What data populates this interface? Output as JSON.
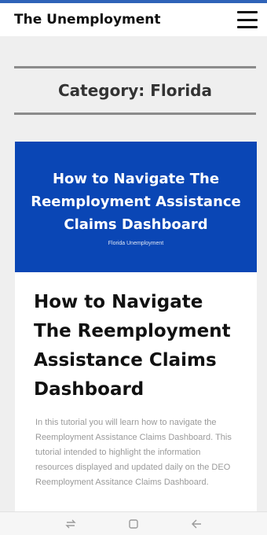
{
  "header": {
    "site_title": "The Unemployment",
    "menu_icon": "hamburger-menu-icon"
  },
  "category": {
    "title": "Category: Florida"
  },
  "post": {
    "banner_title": "How to Navigate The Reemployment Assistance Claims Dashboard",
    "banner_subtitle": "Florida Unemployment",
    "title": "How to Navigate The Reemployment Assistance Claims Dashboard",
    "excerpt": "In this tutorial you will learn how to navigate the Reemployment Assistance Claims Dashboard. This tutorial intended to highlight the information resources displayed and updated daily on the DEO Reemployment Assitance Claims Dashboard.",
    "banner_color": "#0a46b5"
  },
  "system_nav": {
    "recents_icon": "recents-icon",
    "home_icon": "home-square-icon",
    "back_icon": "back-arrow-icon"
  },
  "colors": {
    "accent_strip": "#2f63b8",
    "page_background": "#efefef"
  }
}
